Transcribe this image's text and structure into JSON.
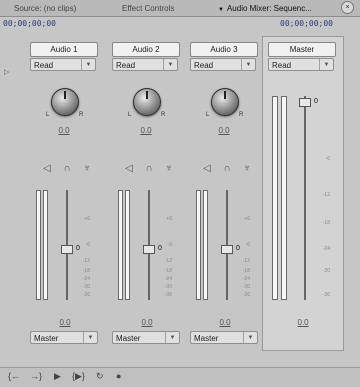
{
  "tabs": [
    {
      "label": "Source: (no clips)"
    },
    {
      "label": "Effect Controls"
    },
    {
      "label": "Audio Mixer: Sequenc..."
    }
  ],
  "timecode_left": "00;00;00;00",
  "timecode_right": "00;00;00;00",
  "channels": [
    {
      "name": "Audio 1",
      "mode": "Read",
      "pan": "0.0",
      "volume": "0.0",
      "output": "Master",
      "pan_l": "L",
      "pan_r": "R"
    },
    {
      "name": "Audio 2",
      "mode": "Read",
      "pan": "0.0",
      "volume": "0.0",
      "output": "Master",
      "pan_l": "L",
      "pan_r": "R"
    },
    {
      "name": "Audio 3",
      "mode": "Read",
      "pan": "0.0",
      "volume": "0.0",
      "output": "Master",
      "pan_l": "L",
      "pan_r": "R"
    }
  ],
  "master": {
    "name": "Master",
    "mode": "Read",
    "volume": "0.0"
  },
  "fader_zero_label": "0",
  "channel_scale": [
    "+6",
    "0",
    "-6",
    "-12",
    "-18",
    "-24",
    "-30",
    "-36"
  ],
  "master_scale": [
    "-6",
    "-12",
    "-18",
    "-24",
    "-30",
    "-36"
  ],
  "icons": {
    "mute": "speaker-icon",
    "solo": "headphones-icon",
    "record": "microphone-icon",
    "close": "close-icon"
  },
  "transport_icons": [
    "go-to-in-icon",
    "go-to-out-icon",
    "play-icon",
    "play-in-to-out-icon",
    "loop-icon",
    "record-icon"
  ],
  "colors": {
    "background": "#c6c6c6",
    "timecode": "#2b3a7a"
  }
}
